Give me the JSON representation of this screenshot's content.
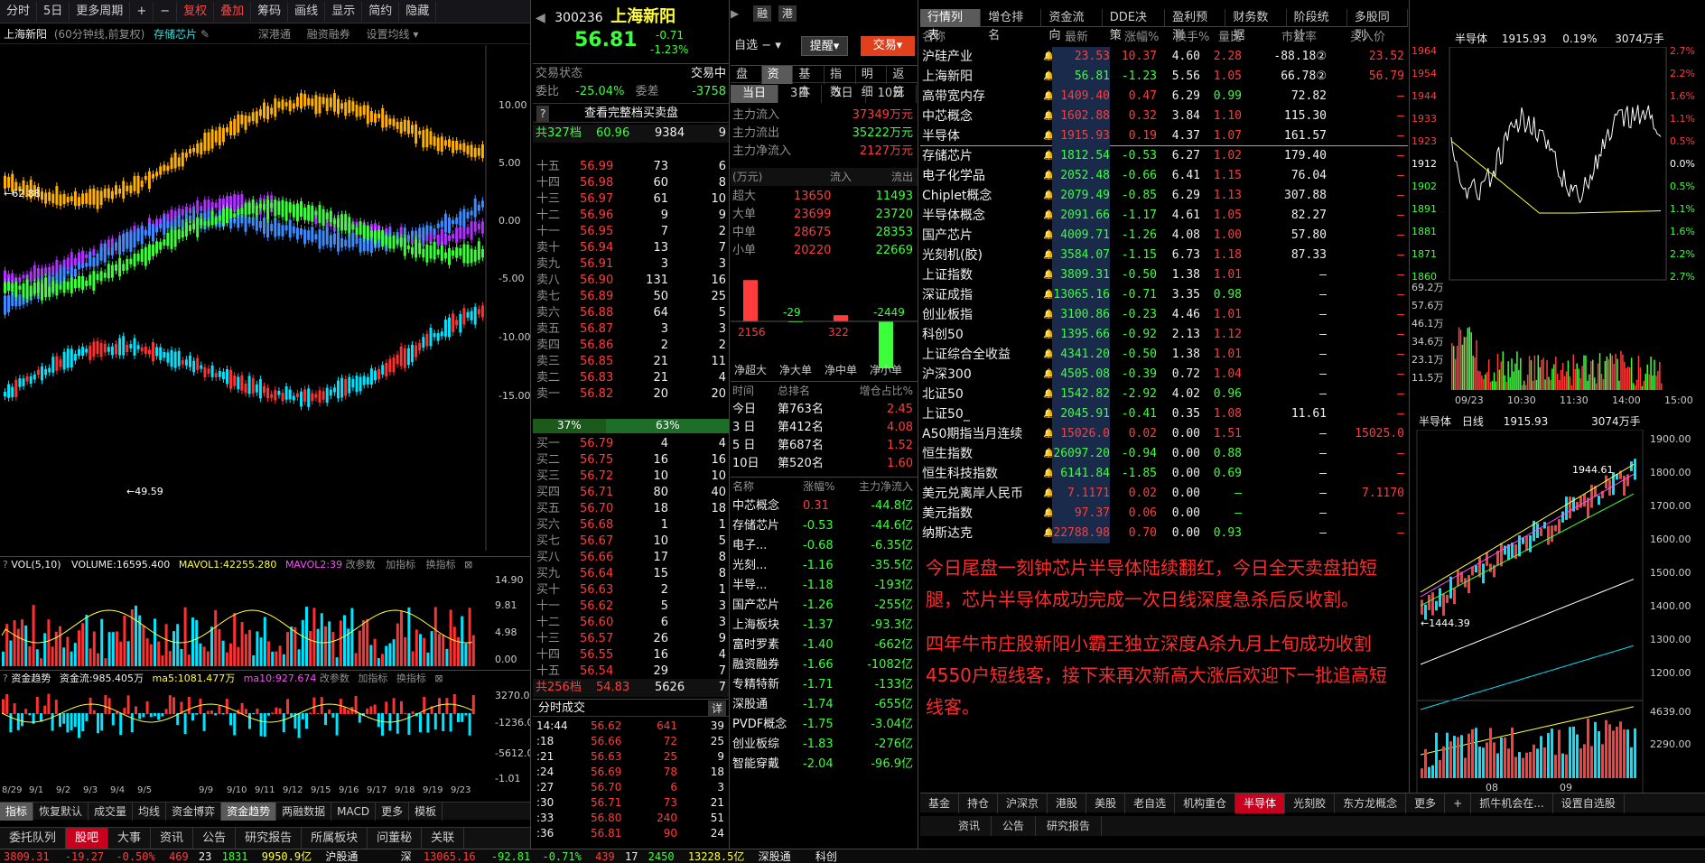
{
  "top_toolbar": {
    "items": [
      "分时",
      "5日",
      "更多周期",
      "+",
      "−",
      "复权",
      "叠加",
      "筹码",
      "画线",
      "显示",
      "简约",
      "隐藏"
    ]
  },
  "chart_header": {
    "name": "上海新阳",
    "info": "(60分钟线,前复权)",
    "related": "存储芯片",
    "links": [
      "深港通",
      "融资融券",
      "设置均线"
    ]
  },
  "kline": {
    "axis": [
      "10.00",
      "5.00",
      "0.00",
      "-5.00",
      "-10.00",
      "-15.00"
    ],
    "high_label": "62.88",
    "low_label": "49.59"
  },
  "vol_bar": {
    "title": "VOL(5,10)",
    "volume": "VOLUME:16595.400",
    "mavol1": "MAVOL1:42255.280",
    "mavol2": "MAVOL2:39",
    "btn1": "改参数",
    "btn2": "加指标",
    "btn3": "换指标",
    "axis": [
      "14.90",
      "9.81",
      "4.98",
      "0.00"
    ]
  },
  "fund_bar": {
    "title": "资金趋势",
    "flow": "资金流:985.405万",
    "ma5": "ma5:1081.477万",
    "ma10": "ma10:927.674",
    "btn1": "改参数",
    "btn2": "加指标",
    "btn3": "换指标",
    "axis": [
      "3270.00",
      "-1236.00",
      "-5612.00",
      "-1.01"
    ]
  },
  "date_axis": [
    "8/29",
    "9/1",
    "9/2",
    "9/3",
    "9/4",
    "9/5",
    "9/9",
    "9/10",
    "9/11",
    "9/12",
    "9/15",
    "9/16",
    "9/17",
    "9/18",
    "9/19",
    "9/23"
  ],
  "indicator_tabs": [
    "指标",
    "恢复默认",
    "成交量",
    "均线",
    "资金博弈",
    "资金趋势",
    "两融数据",
    "MACD",
    "更多",
    "模板"
  ],
  "bottom_tabs": [
    "委托队列",
    "股吧",
    "大事",
    "资讯",
    "公告",
    "研究报告",
    "所属板块",
    "问董秘",
    "关联"
  ],
  "quote": {
    "code": "300236",
    "name": "上海新阳",
    "price": "56.81",
    "chg": "-0.71",
    "pct": "-1.23%",
    "tags": [
      "融",
      "港"
    ],
    "btn_watch": "自选",
    "btn_remind": "提醒",
    "btn_trade": "交易"
  },
  "trade_status": {
    "label": "交易状态",
    "value": "交易中",
    "weibi_label": "委比",
    "weibi": "-25.04%",
    "weicha_label": "委差",
    "weicha": "-3758",
    "full_btn": "查看完整档买卖盘",
    "sell_total_label": "共327档",
    "sell_total_price": "60.96",
    "sell_total_vol": "9384",
    "sell_total_n": "9",
    "buy_total_label": "共256档",
    "buy_total_price": "54.83",
    "buy_total_vol": "5626",
    "buy_total_n": "7",
    "ratio_sell": "37%",
    "ratio_buy": "63%"
  },
  "sell_orders": [
    [
      "十五",
      "56.99",
      "73",
      "6"
    ],
    [
      "十四",
      "56.98",
      "60",
      "8"
    ],
    [
      "十三",
      "56.97",
      "61",
      "10"
    ],
    [
      "十二",
      "56.96",
      "9",
      "9"
    ],
    [
      "十一",
      "56.95",
      "7",
      "2"
    ],
    [
      "卖十",
      "56.94",
      "13",
      "7"
    ],
    [
      "卖九",
      "56.91",
      "3",
      "3"
    ],
    [
      "卖八",
      "56.90",
      "131",
      "16"
    ],
    [
      "卖七",
      "56.89",
      "50",
      "25"
    ],
    [
      "卖六",
      "56.88",
      "64",
      "5"
    ],
    [
      "卖五",
      "56.87",
      "3",
      "3"
    ],
    [
      "卖四",
      "56.86",
      "2",
      "2"
    ],
    [
      "卖三",
      "56.85",
      "21",
      "11"
    ],
    [
      "卖二",
      "56.83",
      "21",
      "4"
    ],
    [
      "卖一",
      "56.82",
      "20",
      "20"
    ]
  ],
  "buy_orders": [
    [
      "买一",
      "56.79",
      "4",
      "4"
    ],
    [
      "买二",
      "56.75",
      "16",
      "16"
    ],
    [
      "买三",
      "56.72",
      "10",
      "10"
    ],
    [
      "买四",
      "56.71",
      "80",
      "40"
    ],
    [
      "买五",
      "56.70",
      "18",
      "18"
    ],
    [
      "买六",
      "56.68",
      "1",
      "1"
    ],
    [
      "买七",
      "56.67",
      "10",
      "5"
    ],
    [
      "买八",
      "56.66",
      "17",
      "8"
    ],
    [
      "买九",
      "56.64",
      "15",
      "8"
    ],
    [
      "买十",
      "56.63",
      "2",
      "1"
    ],
    [
      "十一",
      "56.62",
      "5",
      "3"
    ],
    [
      "十二",
      "56.60",
      "6",
      "3"
    ],
    [
      "十三",
      "56.57",
      "26",
      "9"
    ],
    [
      "十四",
      "56.55",
      "16",
      "4"
    ],
    [
      "十五",
      "56.54",
      "29",
      "7"
    ]
  ],
  "ticks": {
    "title": "分时成交",
    "detail": "详",
    "rows": [
      [
        "14:44",
        "56.62",
        "641",
        "39"
      ],
      [
        ":18",
        "56.66",
        "72",
        "25"
      ],
      [
        ":21",
        "56.63",
        "25",
        "9"
      ],
      [
        ":24",
        "56.69",
        "78",
        "18"
      ],
      [
        ":27",
        "56.70",
        "6",
        "3"
      ],
      [
        ":30",
        "56.71",
        "73",
        "21"
      ],
      [
        ":33",
        "56.80",
        "240",
        "51"
      ],
      [
        ":36",
        "56.81",
        "90",
        "24"
      ]
    ]
  },
  "fund_tabs": [
    "盘口",
    "资金",
    "基本",
    "指数",
    "明细",
    "返笼"
  ],
  "period_tabs": [
    "当日",
    "3日",
    "5日",
    "10日"
  ],
  "main_flow": [
    [
      "主力流入",
      "37349万元"
    ],
    [
      "主力流出",
      "35222万元"
    ],
    [
      "主力净流入",
      "2127万元"
    ]
  ],
  "flow_table": {
    "head": [
      "(万元)",
      "流入",
      "流出"
    ],
    "rows": [
      [
        "超大",
        "13650",
        "11493"
      ],
      [
        "大单",
        "23699",
        "23720"
      ],
      [
        "中单",
        "28675",
        "28353"
      ],
      [
        "小单",
        "20220",
        "22669"
      ]
    ]
  },
  "flow_chart": {
    "values": [
      2156,
      -29,
      322,
      -2449
    ],
    "labels": [
      "2156",
      "-29",
      "322",
      "-2449"
    ],
    "cats": [
      "净超大",
      "净大单",
      "净中单",
      "净小单"
    ]
  },
  "rank": {
    "head": [
      "时间",
      "总排名",
      "增仓占比%"
    ],
    "rows": [
      [
        "今日",
        "第763名",
        "2.45"
      ],
      [
        "3 日",
        "第412名",
        "4.08"
      ],
      [
        "5 日",
        "第687名",
        "1.52"
      ],
      [
        "10日",
        "第520名",
        "1.60"
      ]
    ]
  },
  "sector": {
    "head": [
      "名称",
      "涨幅%",
      "主力净流入"
    ],
    "rows": [
      [
        "中芯概念",
        "0.31",
        "-44.8亿"
      ],
      [
        "存储芯片",
        "-0.53",
        "-44.6亿"
      ],
      [
        "电子...",
        "-0.68",
        "-6.35亿"
      ],
      [
        "光刻...",
        "-1.16",
        "-35.5亿"
      ],
      [
        "半导...",
        "-1.18",
        "-193亿"
      ],
      [
        "国产芯片",
        "-1.26",
        "-255亿"
      ],
      [
        "上海板块",
        "-1.37",
        "-93.3亿"
      ],
      [
        "富时罗素",
        "-1.40",
        "-662亿"
      ],
      [
        "融资融券",
        "-1.66",
        "-1082亿"
      ],
      [
        "专精特新",
        "-1.71",
        "-133亿"
      ],
      [
        "深股通",
        "-1.74",
        "-655亿"
      ],
      [
        "PVDF概念",
        "-1.75",
        "-3.04亿"
      ],
      [
        "创业板综",
        "-1.83",
        "-276亿"
      ],
      [
        "智能穿戴",
        "-2.04",
        "-96.9亿"
      ]
    ]
  },
  "market_tabs": [
    "行情列表",
    "增仓排名",
    "资金流向",
    "DDE决策",
    "盈利预测",
    "财务数据",
    "阶段统计",
    "多股同列"
  ],
  "market_head": [
    "名称",
    "最新",
    "涨幅%",
    "换手%",
    "量比",
    "市盈率",
    "买入价"
  ],
  "market_rows": [
    [
      "沪硅产业",
      "23.53",
      "10.37",
      "4.60",
      "2.28",
      "-88.18②",
      "23.52"
    ],
    [
      "上海新阳",
      "56.81",
      "-1.23",
      "5.56",
      "1.05",
      "66.78②",
      "56.79"
    ],
    [
      "高带宽内存",
      "1409.40",
      "0.47",
      "6.29",
      "0.99",
      "72.82",
      "—"
    ],
    [
      "中芯概念",
      "1602.88",
      "0.32",
      "3.84",
      "1.10",
      "115.30",
      "—"
    ],
    [
      "半导体",
      "1915.93",
      "0.19",
      "4.37",
      "1.07",
      "161.57",
      "—"
    ],
    [
      "存储芯片",
      "1812.54",
      "-0.53",
      "6.27",
      "1.02",
      "179.40",
      "—"
    ],
    [
      "电子化学品",
      "2052.48",
      "-0.66",
      "6.41",
      "1.15",
      "76.04",
      "—"
    ],
    [
      "Chiplet概念",
      "2079.49",
      "-0.85",
      "6.29",
      "1.13",
      "307.88",
      "—"
    ],
    [
      "半导体概念",
      "2091.66",
      "-1.17",
      "4.61",
      "1.05",
      "82.27",
      "—"
    ],
    [
      "国产芯片",
      "4009.71",
      "-1.26",
      "4.08",
      "1.00",
      "57.80",
      "—"
    ],
    [
      "光刻机(胶)",
      "3584.07",
      "-1.15",
      "6.73",
      "1.18",
      "87.33",
      "—"
    ],
    [
      "上证指数",
      "3809.31",
      "-0.50",
      "1.38",
      "1.01",
      "—",
      "—"
    ],
    [
      "深证成指",
      "13065.16",
      "-0.71",
      "3.35",
      "0.98",
      "—",
      "—"
    ],
    [
      "创业板指",
      "3100.86",
      "-0.23",
      "4.46",
      "1.01",
      "—",
      "—"
    ],
    [
      "科创50",
      "1395.66",
      "-0.92",
      "2.13",
      "1.12",
      "—",
      "—"
    ],
    [
      "上证综合全收益",
      "4341.20",
      "-0.50",
      "1.38",
      "1.01",
      "—",
      "—"
    ],
    [
      "沪深300",
      "4505.08",
      "-0.39",
      "0.72",
      "1.04",
      "—",
      "—"
    ],
    [
      "北证50",
      "1542.82",
      "-2.92",
      "4.02",
      "0.96",
      "—",
      "—"
    ],
    [
      "上证50_",
      "2045.91",
      "-0.41",
      "0.35",
      "1.08",
      "11.61",
      "—"
    ],
    [
      "A50期指当月连续",
      "15026.0",
      "0.02",
      "0.00",
      "1.51",
      "—",
      "15025.0"
    ],
    [
      "恒生指数",
      "26097.20",
      "-0.94",
      "0.00",
      "0.88",
      "—",
      "—"
    ],
    [
      "恒生科技指数",
      "6141.84",
      "-1.85",
      "0.00",
      "0.69",
      "—",
      "—"
    ],
    [
      "美元兑离岸人民币",
      "7.1171",
      "0.02",
      "0.00",
      "—",
      "—",
      "7.1170"
    ],
    [
      "美元指数",
      "97.37",
      "0.06",
      "0.00",
      "—",
      "—",
      "—"
    ],
    [
      "纳斯达克",
      "22788.98",
      "0.70",
      "0.00",
      "0.93",
      "—",
      "—"
    ]
  ],
  "commentary": [
    "今日尾盘一刻钟芯片半导体陆续翻红，今日全天卖盘拍短腿，芯片半导体成功完成一次日线深度急杀后反收割。",
    "四年牛市庄股新阳小霸王独立深度A杀九月上旬成功收割4550户短线客，接下来再次新高大涨后欢迎下一批追高短线客。"
  ],
  "mini_intraday": {
    "name": "半导体",
    "price": "1915.93",
    "pct": "0.19%",
    "amount": "3074万手",
    "left_axis": [
      "1964",
      "1954",
      "1944",
      "1933",
      "1923",
      "1912",
      "1902",
      "1891",
      "1881",
      "1871",
      "1860"
    ],
    "right_axis": [
      "2.7%",
      "2.2%",
      "1.6%",
      "1.1%",
      "0.5%",
      "0.0%",
      "0.5%",
      "1.1%",
      "1.6%",
      "2.2%",
      "2.7%"
    ],
    "vol_axis": [
      "69.2万",
      "57.6万",
      "46.1万",
      "34.6万",
      "23.1万",
      "11.5万"
    ],
    "times": [
      "09/23",
      "10:30",
      "11:30",
      "14:00",
      "15:00"
    ]
  },
  "mini_daily": {
    "name": "半导体",
    "period": "日线",
    "price": "1915.93",
    "amount": "3074万手",
    "high": "1944.61",
    "low": "1444.39",
    "axis": [
      "1900.00",
      "1800.00",
      "1700.00",
      "1600.00",
      "1500.00",
      "1400.00",
      "1300.00",
      "1200.00"
    ],
    "vol_axis": [
      "4639.00",
      "2290.00"
    ],
    "months": [
      "08",
      "09"
    ]
  },
  "sector_tabs": [
    "基金",
    "持仓",
    "沪深京",
    "港股",
    "美股",
    "老自选",
    "机构重仓",
    "半导体",
    "光刻胶",
    "东方龙概念",
    "更多",
    "+",
    "抓牛机会在...",
    "设置自选股"
  ],
  "sub_tabs": [
    "资讯",
    "公告",
    "研究报告"
  ],
  "status_bar": {
    "sh": "3809.31",
    "sh_c": "-19.27",
    "sh_p": "-0.50%",
    "sh_v1": "469",
    "sh_v2": "23",
    "sh_v3": "1831",
    "sh_amt": "9950.9亿",
    "sh_conn": "沪股通",
    "sz_label": "深",
    "sz": "13065.16",
    "sz_c": "-92.81",
    "sz_p": "-0.71%",
    "sz_v1": "439",
    "sz_v2": "17",
    "sz_v3": "2450",
    "sz_amt": "13228.5亿",
    "sz_conn": "深股通",
    "kc": "科创"
  },
  "colors": {
    "up": "#ff3c3c",
    "down": "#3cff3c",
    "accent": "#c8001e"
  }
}
